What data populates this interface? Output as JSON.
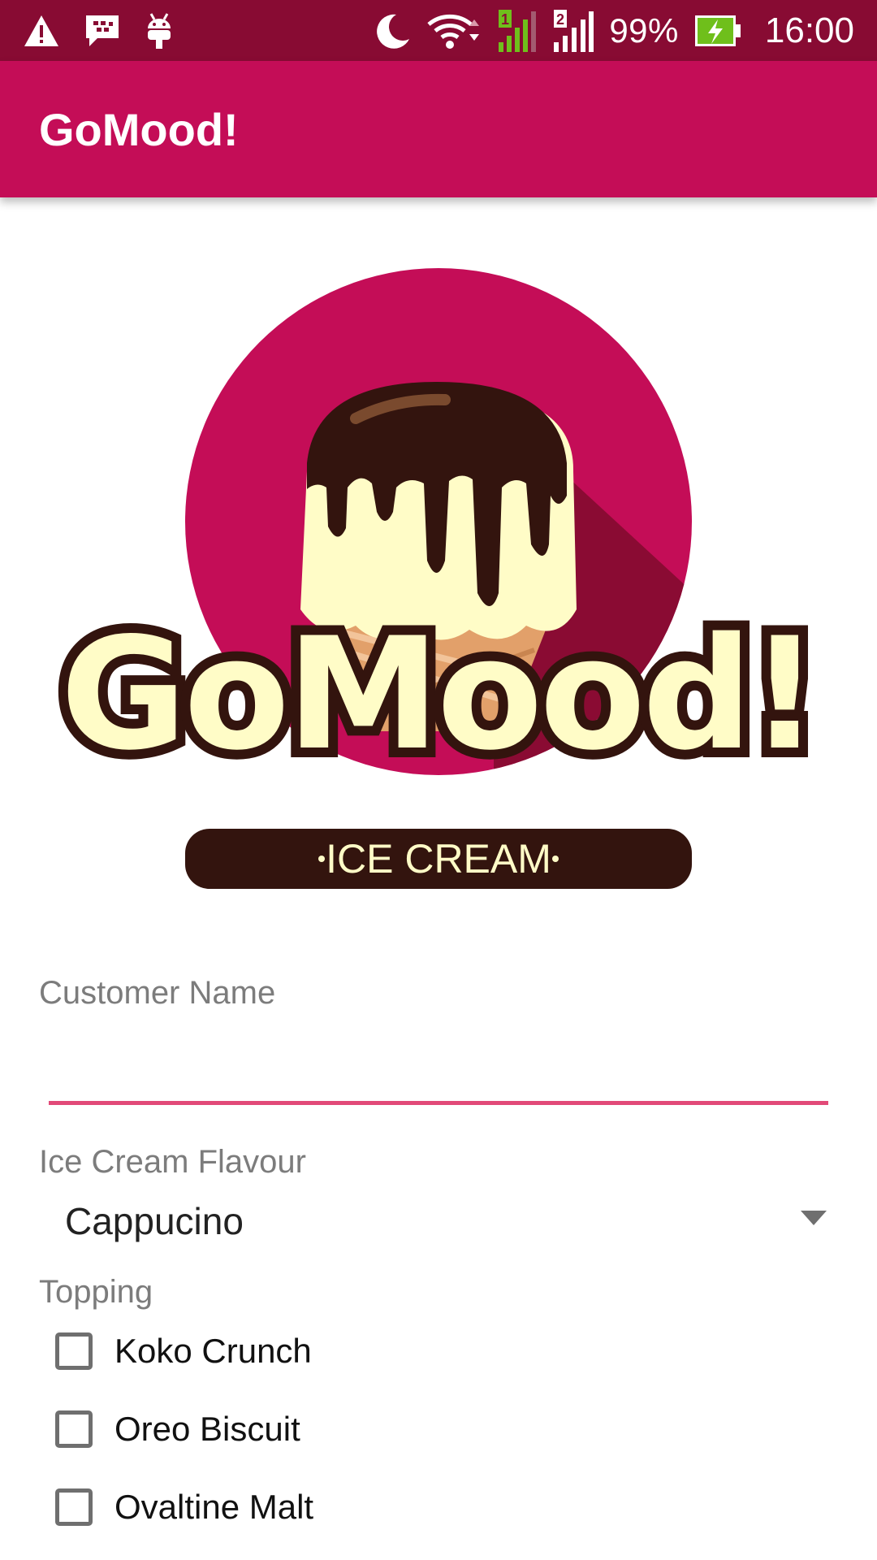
{
  "status_bar": {
    "icons_left": [
      "warning-icon",
      "bbm-icon",
      "android-debug-icon"
    ],
    "icons_right": [
      "do-not-disturb-moon-icon",
      "wifi-icon",
      "sim1-signal-icon",
      "sim2-signal-icon",
      "battery-charging-icon"
    ],
    "sim1_label": "1",
    "sim2_label": "2",
    "battery": "99%",
    "time": "16:00",
    "colors": {
      "background": "#880b33",
      "signal_green": "#6fbf1b"
    }
  },
  "app_bar": {
    "title": "GoMood!",
    "color": "#c40d57"
  },
  "logo": {
    "brand": "GoMood!",
    "tagline": "ICE CREAM",
    "colors": {
      "circle": "#c40d57",
      "cream": "#fffcc7",
      "chocolate": "#33140e",
      "cone": "#e2a06a"
    }
  },
  "form": {
    "customer_name": {
      "label": "Customer Name",
      "value": "",
      "placeholder": ""
    },
    "flavour": {
      "label": "Ice Cream Flavour",
      "selected": "Cappucino"
    },
    "topping": {
      "label": "Topping",
      "options": [
        {
          "label": "Koko Crunch",
          "checked": false
        },
        {
          "label": "Oreo Biscuit",
          "checked": false
        },
        {
          "label": "Ovaltine Malt",
          "checked": false
        }
      ]
    }
  }
}
